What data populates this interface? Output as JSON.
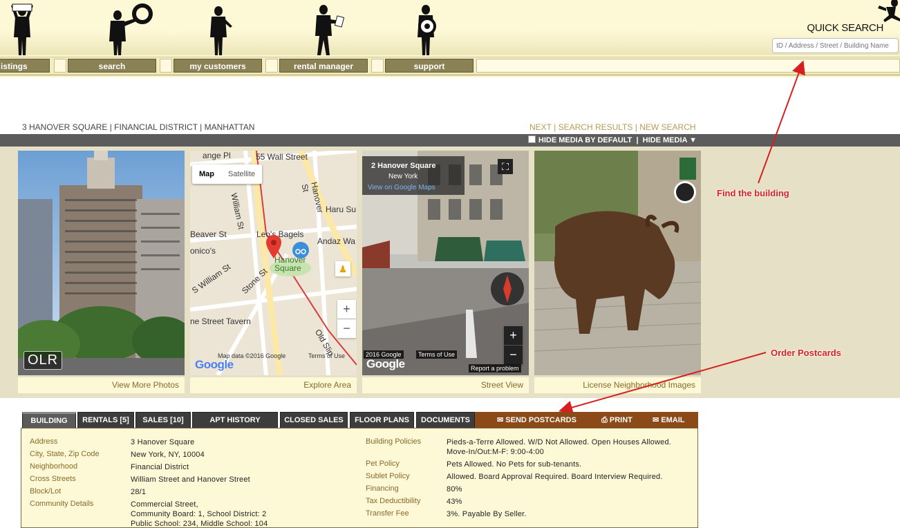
{
  "header": {
    "quick_search_label": "QUICK SEARCH",
    "search_placeholder": "ID / Address / Street / Building Name",
    "nav": [
      "istings",
      "search",
      "my customers",
      "rental manager",
      "support"
    ]
  },
  "breadcrumb": {
    "location": "3 HANOVER SQUARE | FINANCIAL DISTRICT | MANHATTAN",
    "next": "NEXT",
    "search_results": "SEARCH RESULTS",
    "new_search": "NEW SEARCH",
    "sep": " | "
  },
  "media_bar": {
    "hide_default": "HIDE MEDIA BY DEFAULT",
    "hide_media": "HIDE MEDIA ▼"
  },
  "gallery": {
    "captions": [
      "View More Photos",
      "Explore Area",
      "Street View",
      "License Neighborhood Images"
    ],
    "photo_watermark": "OLR",
    "map": {
      "toggle_map": "Map",
      "toggle_satellite": "Satellite",
      "labels": [
        "55 Wall Street",
        "ange Pl",
        "William St",
        "Hanover St",
        "Haru Su",
        "Beaver St",
        "Leo's Bagels",
        "Andaz Wa",
        "onico's",
        "Hanover Square",
        "S William St",
        "Stone St",
        "ne Street Tavern",
        "Old Slip"
      ],
      "attribution": "Map data ©2016 Google",
      "terms": "Terms of Use",
      "logo": "Google"
    },
    "street_view": {
      "title": "2 Hanover Square",
      "subtitle": "New York",
      "link": "View on Google Maps",
      "copyright": "2016 Google",
      "terms": "Terms of Use",
      "report": "Report a problem",
      "logo": "Google"
    }
  },
  "annotations": {
    "find": "Find the building",
    "order": "Order Postcards"
  },
  "tabs": [
    "BUILDING",
    "RENTALS [5]",
    "SALES [10]",
    "APT HISTORY",
    "CLOSED SALES",
    "FLOOR PLANS",
    "DOCUMENTS"
  ],
  "tools": {
    "postcards": "SEND POSTCARDS",
    "print": "PRINT",
    "email": "EMAIL"
  },
  "details_left": [
    {
      "label": "Address",
      "value": "3 Hanover Square"
    },
    {
      "label": "City, State, Zip Code",
      "value": "New York, NY, 10004"
    },
    {
      "label": "Neighborhood",
      "value": "Financial District"
    },
    {
      "label": "Cross Streets",
      "value": "William Street and Hanover Street"
    },
    {
      "label": "Block/Lot",
      "value": "28/1"
    },
    {
      "label": "Community Details",
      "value": "Commercial Street,",
      "value2": "Community Board: 1, School District: 2",
      "value3": "Public School: 234, Middle School: 104"
    }
  ],
  "details_right": [
    {
      "label": "Building Policies",
      "value": "Pieds-a-Terre Allowed. W/D Not Allowed. Open Houses Allowed.",
      "value2": "Move-In/Out:M-F: 9:00-4:00"
    },
    {
      "label": "Pet Policy",
      "value": "Pets Allowed. No Pets for sub-tenants."
    },
    {
      "label": "Sublet Policy",
      "value": "Allowed. Board Approval Required. Board Interview Required."
    },
    {
      "label": "Financing",
      "value": "80%"
    },
    {
      "label": "Tax Deductibility",
      "value": "43%"
    },
    {
      "label": "Transfer Fee",
      "value": "3%. Payable By Seller."
    }
  ]
}
